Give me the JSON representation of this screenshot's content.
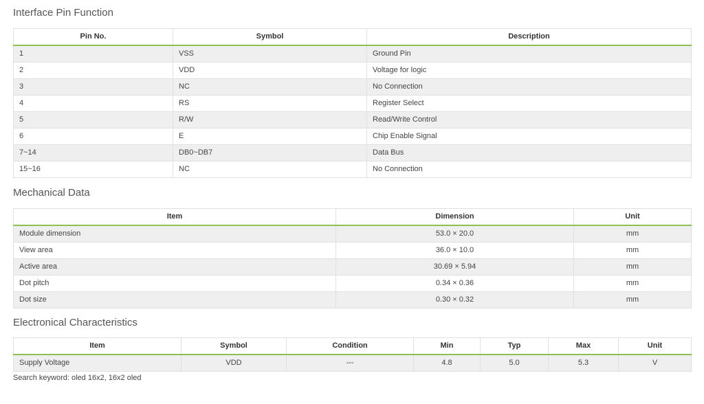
{
  "sections": {
    "pin_title": "Interface Pin Function",
    "mech_title": "Mechanical Data",
    "elec_title": "Electronical Characteristics"
  },
  "pin_table": {
    "headers": [
      "Pin No.",
      "Symbol",
      "Description"
    ],
    "rows": [
      [
        "1",
        "VSS",
        "Ground Pin"
      ],
      [
        "2",
        "VDD",
        "Voltage for logic"
      ],
      [
        "3",
        "NC",
        "No Connection"
      ],
      [
        "4",
        "RS",
        "Register Select"
      ],
      [
        "5",
        "R/W",
        "Read/Write Control"
      ],
      [
        "6",
        "E",
        "Chip Enable Signal"
      ],
      [
        "7~14",
        "DB0~DB7",
        "Data Bus"
      ],
      [
        "15~16",
        "NC",
        "No Connection"
      ]
    ]
  },
  "mech_table": {
    "headers": [
      "Item",
      "Dimension",
      "Unit"
    ],
    "rows": [
      [
        "Module dimension",
        "53.0 × 20.0",
        "mm"
      ],
      [
        "View area",
        "36.0 × 10.0",
        "mm"
      ],
      [
        "Active area",
        "30.69 × 5.94",
        "mm"
      ],
      [
        "Dot pitch",
        "0.34 × 0.36",
        "mm"
      ],
      [
        "Dot size",
        "0.30 × 0.32",
        "mm"
      ]
    ]
  },
  "elec_table": {
    "headers": [
      "Item",
      "Symbol",
      "Condition",
      "Min",
      "Typ",
      "Max",
      "Unit"
    ],
    "rows": [
      [
        "Supply Voltage",
        "VDD",
        "---",
        "4.8",
        "5.0",
        "5.3",
        "V"
      ]
    ]
  },
  "footer": {
    "text": "Search keyword: oled 16x2, 16x2 oled"
  }
}
